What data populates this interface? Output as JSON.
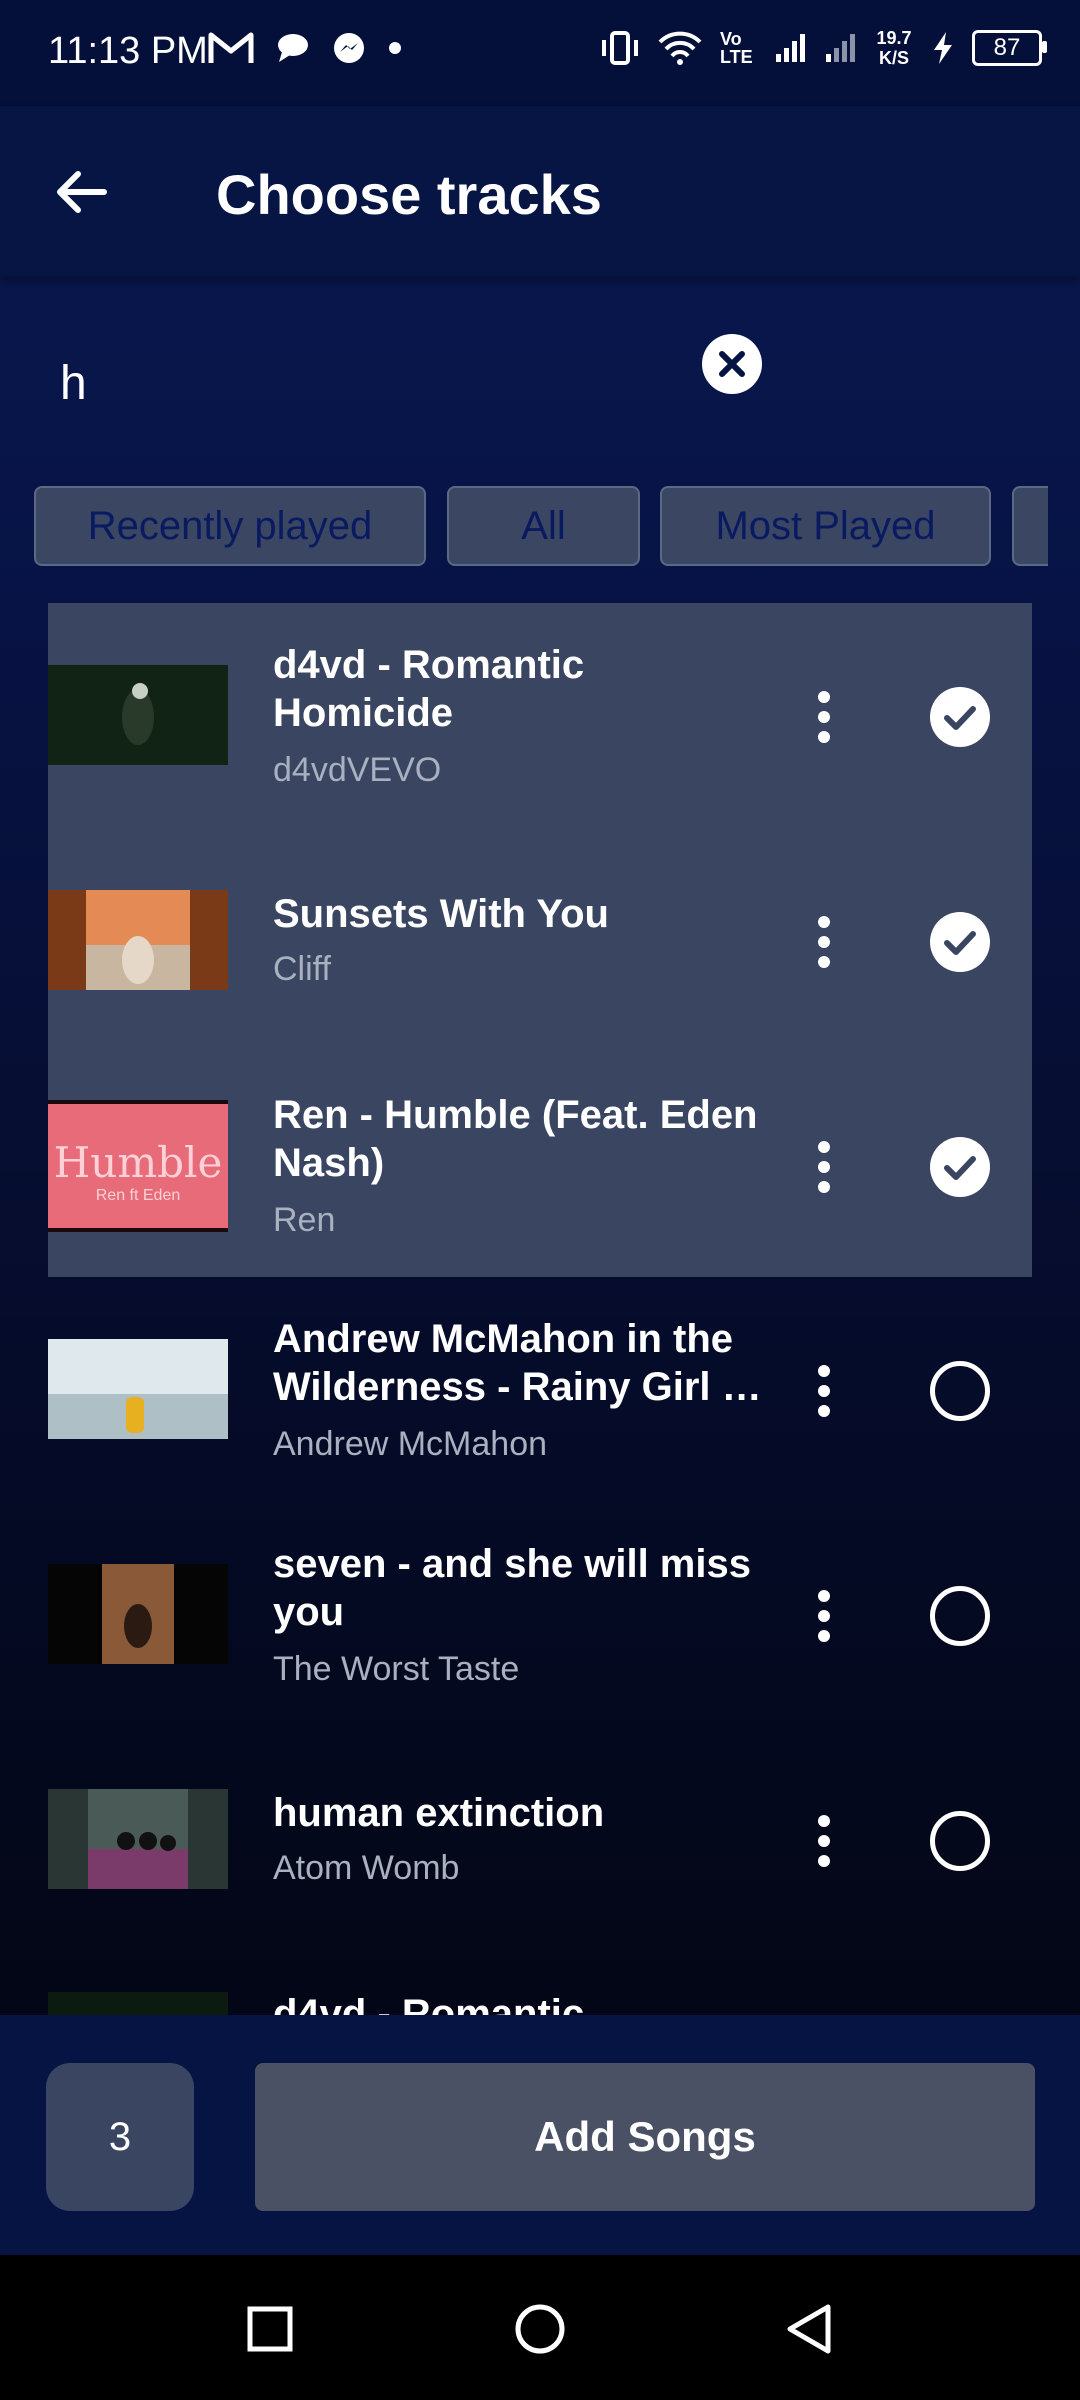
{
  "status_bar": {
    "time": "11:13 PM",
    "network_speed": "19.7 K/S",
    "volte": "Vo LTE",
    "battery": "87"
  },
  "app_bar": {
    "title": "Choose tracks"
  },
  "search": {
    "value": "h"
  },
  "chips": [
    "Recently played",
    "All",
    "Most Played"
  ],
  "tracks": [
    {
      "title": "d4vd - Romantic Homicide",
      "artist": "d4vdVEVO",
      "selected": true,
      "thumb_color": "#0d1a10"
    },
    {
      "title": "Sunsets With You",
      "artist": "Cliff",
      "selected": true,
      "thumb_color": "#b85a2a"
    },
    {
      "title": "Ren  - Humble (Feat. Eden Nash)",
      "artist": "Ren",
      "selected": true,
      "thumb_color": "#e86b7a",
      "thumb_text": "Humble",
      "thumb_sub": "Ren ft Eden"
    },
    {
      "title": "Andrew McMahon in the Wilderness - Rainy Girl …",
      "artist": "Andrew McMahon",
      "selected": false,
      "thumb_color": "#c8d3d8"
    },
    {
      "title": "seven - and she will miss you",
      "artist": "The Worst Taste",
      "selected": false,
      "thumb_color": "#7a4a30"
    },
    {
      "title": "human extinction",
      "artist": "Atom Womb",
      "selected": false,
      "thumb_color": "#3a4a48"
    },
    {
      "title": "d4vd - Romantic",
      "artist": "",
      "selected": false,
      "thumb_color": "#0d1a10"
    }
  ],
  "bottom": {
    "count": "3",
    "add_label": "Add Songs"
  },
  "colors": {
    "selected_row": "#3a4562",
    "chip_text": "#0a1a60",
    "app_bar": "#061544"
  }
}
